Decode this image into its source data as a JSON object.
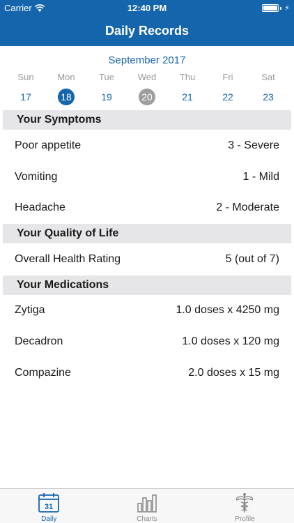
{
  "status": {
    "carrier": "Carrier",
    "time": "12:40 PM"
  },
  "nav": {
    "title": "Daily Records"
  },
  "calendar": {
    "month": "September 2017",
    "days": [
      {
        "name": "Sun",
        "num": "17"
      },
      {
        "name": "Mon",
        "num": "18"
      },
      {
        "name": "Tue",
        "num": "19"
      },
      {
        "name": "Wed",
        "num": "20"
      },
      {
        "name": "Thu",
        "num": "21"
      },
      {
        "name": "Fri",
        "num": "22"
      },
      {
        "name": "Sat",
        "num": "23"
      }
    ]
  },
  "symptoms": {
    "header": "Your Symptoms",
    "rows": [
      {
        "label": "Poor appetite",
        "value": "3 - Severe"
      },
      {
        "label": "Vomiting",
        "value": "1 - Mild"
      },
      {
        "label": "Headache",
        "value": "2 - Moderate"
      }
    ]
  },
  "quality": {
    "header": "Your Quality of Life",
    "rows": [
      {
        "label": "Overall Health Rating",
        "value": "5 (out of 7)"
      }
    ]
  },
  "medications": {
    "header": "Your Medications",
    "rows": [
      {
        "label": "Zytiga",
        "value": "1.0 doses x 4250 mg"
      },
      {
        "label": "Decadron",
        "value": "1.0 doses x 120 mg"
      },
      {
        "label": "Compazine",
        "value": "2.0 doses x 15 mg"
      }
    ]
  },
  "tabs": {
    "daily": "Daily",
    "charts": "Charts",
    "profile": "Profile",
    "daily_icon_num": "31"
  },
  "colors": {
    "accent": "#1565ad",
    "today": "#9e9e9e",
    "section": "#e6e6e8"
  }
}
